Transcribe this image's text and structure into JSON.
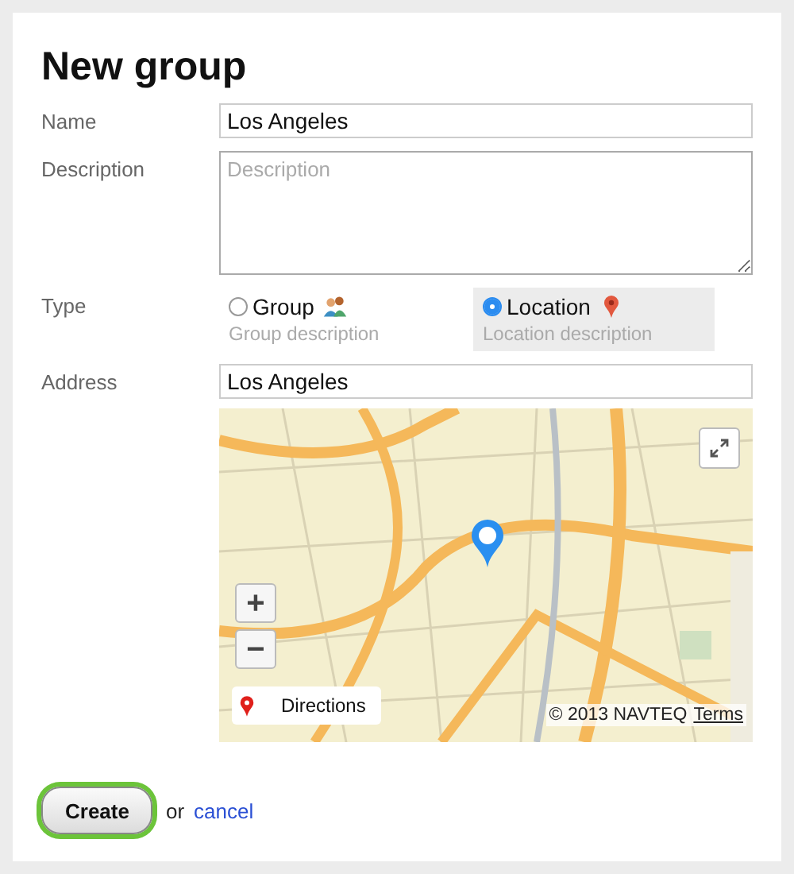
{
  "title": "New group",
  "fields": [
    {
      "label": "Name",
      "kind": "input",
      "value": "Los Angeles"
    },
    {
      "label": "Description",
      "kind": "textarea",
      "placeholder": "Description"
    }
  ],
  "type": {
    "label": "Type",
    "options": [
      {
        "label": "Group",
        "kind": "group",
        "description": "Group description",
        "selected": false
      },
      {
        "label": "Location",
        "kind": "location",
        "description": "Location description",
        "selected": true
      }
    ]
  },
  "address": {
    "label": "Address",
    "value": "Los Angeles"
  },
  "map": {
    "kind": "picture",
    "directions": "Directions",
    "attribution": "© 2013 NAVTEQ",
    "terms_link": "Terms",
    "zoom_in": "+",
    "zoom_out": "−"
  },
  "actions": {
    "create": "Create",
    "separator": "or",
    "cancel": "cancel"
  }
}
